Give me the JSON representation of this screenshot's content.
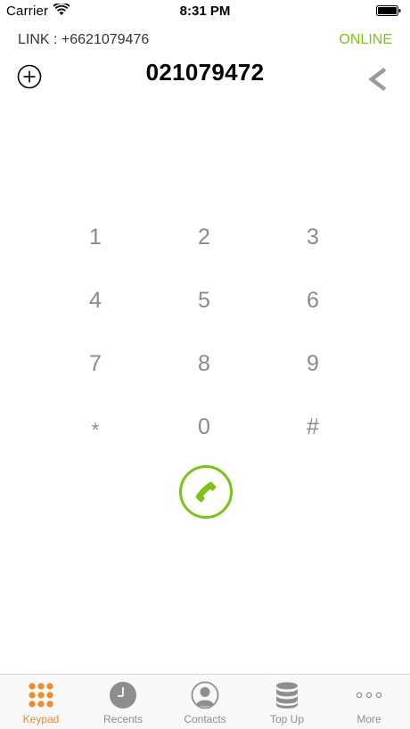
{
  "status_bar": {
    "carrier": "Carrier",
    "time": "8:31 PM"
  },
  "header": {
    "link_label": "LINK : +6621079476",
    "status": "ONLINE"
  },
  "dialer": {
    "number": "021079472",
    "keys": [
      "1",
      "2",
      "3",
      "4",
      "5",
      "6",
      "7",
      "8",
      "9",
      "*",
      "0",
      "#"
    ]
  },
  "tabs": [
    {
      "label": "Keypad",
      "icon": "keypad-icon",
      "active": true
    },
    {
      "label": "Recents",
      "icon": "clock-icon",
      "active": false
    },
    {
      "label": "Contacts",
      "icon": "contact-icon",
      "active": false
    },
    {
      "label": "Top Up",
      "icon": "database-icon",
      "active": false
    },
    {
      "label": "More",
      "icon": "more-icon",
      "active": false
    }
  ],
  "colors": {
    "accent_green": "#7dc216",
    "accent_orange": "#f08a2c",
    "key_gray": "#8a8a8a",
    "tab_gray": "#8e8e8e"
  }
}
